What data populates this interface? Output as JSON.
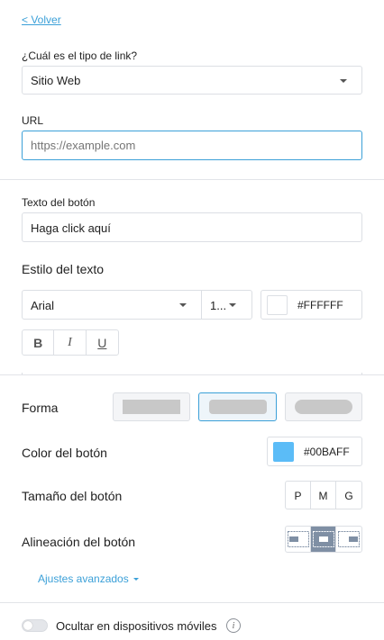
{
  "nav": {
    "back_label": "< Volver"
  },
  "link_type": {
    "label": "¿Cuál es el tipo de link?",
    "value": "Sitio Web"
  },
  "url": {
    "label": "URL",
    "placeholder": "https://example.com"
  },
  "button_text": {
    "label": "Texto del botón",
    "value": "Haga click aquí"
  },
  "text_style": {
    "heading": "Estilo del texto",
    "font": "Arial",
    "size": "1...",
    "color_hex": "#FFFFFF",
    "bold": "B",
    "italic": "I",
    "underline": "U"
  },
  "shape": {
    "label": "Forma"
  },
  "button_color": {
    "label": "Color del botón",
    "hex": "#00BAFF",
    "swatch": "#5bbcf7"
  },
  "button_size": {
    "label": "Tamaño del botón",
    "options": [
      "P",
      "M",
      "G"
    ]
  },
  "alignment": {
    "label": "Alineación del botón",
    "options": [
      "left",
      "center",
      "right"
    ],
    "selected": "center"
  },
  "advanced": {
    "label": "Ajustes avanzados"
  },
  "mobile": {
    "label": "Ocultar en dispositivos móviles",
    "enabled": false
  },
  "colors": {
    "accent": "#3ba0d8",
    "selected_border": "#3ba0d8",
    "align_selected": "#7f8fa4"
  }
}
